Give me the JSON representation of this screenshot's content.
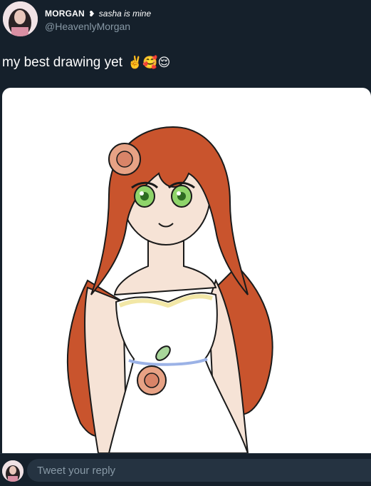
{
  "tweet": {
    "display_name": "MORGAN",
    "name_symbol": "❥",
    "name_suffix": "sasha is mine",
    "handle": "@HeavenlyMorgan",
    "text": "my best drawing yet",
    "emojis": "✌️🥰😌"
  },
  "reply": {
    "placeholder": "Tweet your reply"
  },
  "colors": {
    "background": "#15202b",
    "handle": "#8899a6",
    "hair": "#c9542d",
    "dress": "#ffffff"
  },
  "icons": {
    "avatar": "user-avatar",
    "reply_avatar": "reply-avatar"
  }
}
